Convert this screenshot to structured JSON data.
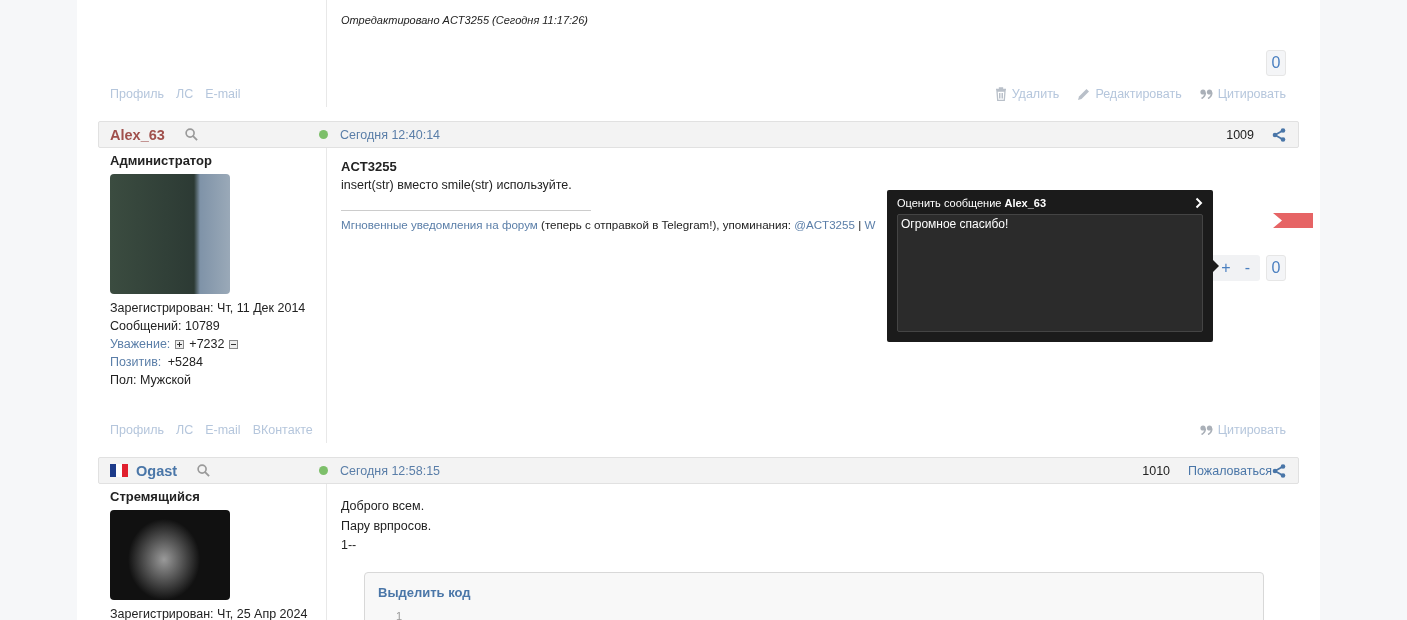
{
  "top_post": {
    "edited_note": "Отредактировано ACT3255 (Сегодня 11:17:26)",
    "rating_count": "0",
    "profile_links": [
      "Профиль",
      "ЛС",
      "E-mail"
    ],
    "actions": [
      {
        "kind": "delete",
        "label": "Удалить"
      },
      {
        "kind": "edit",
        "label": "Редактировать"
      },
      {
        "kind": "quote",
        "label": "Цитировать"
      }
    ]
  },
  "posts": [
    {
      "author": "Alex_63",
      "color": "#a0504c",
      "flag": false,
      "online": true,
      "date": "Сегодня 12:40:14",
      "number": "1009",
      "rank": "Администратор",
      "stats": [
        {
          "kind": "plain",
          "label": "Зарегистрирован:",
          "value": "Чт, 11 Дек 2014"
        },
        {
          "kind": "plain",
          "label": "Сообщений:",
          "value": "10789"
        },
        {
          "kind": "vote",
          "label": "Уважение:",
          "value": "+7232"
        },
        {
          "kind": "link",
          "label": "Позитив:",
          "value": "+5284"
        },
        {
          "kind": "plain",
          "label": "Пол:",
          "value": "Мужской"
        }
      ],
      "body": [
        {
          "kind": "bold",
          "text": "ACT3255"
        },
        {
          "kind": "text",
          "text": "insert(str) вместо smile(str) используйте."
        }
      ],
      "signature": [
        {
          "kind": "link",
          "text": "Мгновенные уведомления на форум"
        },
        {
          "kind": "text",
          "text": " (теперь с отправкой в Telegram!), упоминания: "
        },
        {
          "kind": "link",
          "text": "@ACT3255"
        },
        {
          "kind": "text",
          "text": " | "
        },
        {
          "kind": "link",
          "text": "W"
        }
      ],
      "rating": {
        "plus": "+",
        "minus": "-",
        "count": "0"
      },
      "ribbon": true,
      "profile_links": [
        "Профиль",
        "ЛС",
        "E-mail",
        "ВКонтакте"
      ],
      "actions": [
        {
          "kind": "quote",
          "label": "Цитировать"
        }
      ]
    },
    {
      "author": "Ogast",
      "color": "#4a76a8",
      "flag": true,
      "online": true,
      "date": "Сегодня 12:58:15",
      "number": "1010",
      "report": "Пожаловаться",
      "rank": "Стремящийся",
      "stats": [
        {
          "kind": "plain",
          "label": "Зарегистрирован:",
          "value": "Чт, 25 Апр 2024"
        }
      ],
      "body": [
        {
          "kind": "text",
          "text": "Доброго всем."
        },
        {
          "kind": "text",
          "text": "Пару врпросов."
        },
        {
          "kind": "text",
          "text": "1--"
        }
      ],
      "code": {
        "title": "Выделить код",
        "line_numbers": [
          "1"
        ]
      }
    }
  ],
  "rate_popup": {
    "title": "Оценить сообщение **Alex_63**",
    "value": "Огромное спасибо!"
  }
}
